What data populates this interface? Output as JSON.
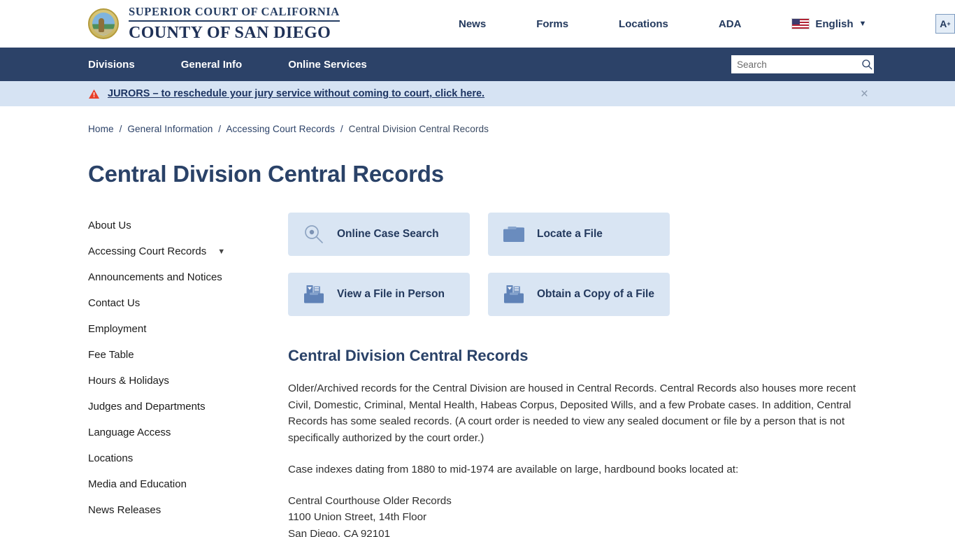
{
  "header": {
    "logo_line1": "SUPERIOR COURT OF CALIFORNIA",
    "logo_line2": "COUNTY OF SAN DIEGO",
    "seal_icon": "california-state-seal",
    "util_nav": [
      {
        "label": "News"
      },
      {
        "label": "Forms"
      },
      {
        "label": "Locations"
      },
      {
        "label": "ADA"
      }
    ],
    "language": {
      "label": "English",
      "flag_icon": "us-flag-icon",
      "caret_icon": "chevron-down-icon"
    },
    "accessibility": {
      "label": "A",
      "sup": "+",
      "name": "increase-text-size"
    }
  },
  "mainnav": {
    "items": [
      {
        "label": "Divisions"
      },
      {
        "label": "General Info"
      },
      {
        "label": "Online Services"
      }
    ],
    "search": {
      "placeholder": "Search",
      "value": "",
      "icon": "search-icon"
    }
  },
  "alert": {
    "icon": "warning-triangle-icon",
    "text": "JURORS – to reschedule your jury service without coming to court, click here.",
    "close_icon": "close-icon",
    "close_label": "×"
  },
  "breadcrumb": {
    "items": [
      {
        "label": "Home",
        "current": false
      },
      {
        "label": "General Information",
        "current": false
      },
      {
        "label": "Accessing Court Records",
        "current": false
      },
      {
        "label": "Central Division Central Records",
        "current": true
      }
    ],
    "separator": "/"
  },
  "page": {
    "title": "Central Division Central Records"
  },
  "sidebar": {
    "items": [
      {
        "label": "About Us",
        "expandable": false
      },
      {
        "label": "Accessing Court Records",
        "expandable": true,
        "caret": "⌄"
      },
      {
        "label": "Announcements and Notices",
        "expandable": false
      },
      {
        "label": "Contact Us",
        "expandable": false
      },
      {
        "label": "Employment",
        "expandable": false
      },
      {
        "label": "Fee Table",
        "expandable": false
      },
      {
        "label": "Hours & Holidays",
        "expandable": false
      },
      {
        "label": "Judges and Departments",
        "expandable": false
      },
      {
        "label": "Language Access",
        "expandable": false
      },
      {
        "label": "Locations",
        "expandable": false
      },
      {
        "label": "Media and Education",
        "expandable": false
      },
      {
        "label": "News Releases",
        "expandable": false
      }
    ]
  },
  "tiles": [
    {
      "label": "Online Case Search",
      "icon": "magnifier-icon"
    },
    {
      "label": "Locate a File",
      "icon": "folder-icon"
    },
    {
      "label": "View a File in Person",
      "icon": "file-box-icon"
    },
    {
      "label": "Obtain a Copy of a File",
      "icon": "file-box-icon"
    }
  ],
  "main": {
    "section_title": "Central Division Central Records",
    "paragraphs": [
      "Older/Archived records for the Central Division are housed in Central Records. Central Records also houses more recent Civil, Domestic, Criminal, Mental Health, Habeas Corpus, Deposited Wills, and a few Probate cases. In addition, Central Records has some sealed records. (A court order is needed to view any sealed document or file by a person that is not specifically authorized by the court order.)",
      "Case indexes dating from 1880 to mid-1974 are available on large, hardbound books located at:"
    ],
    "address": {
      "line1": "Central Courthouse Older Records",
      "line2": "1100 Union Street, 14th Floor",
      "line3": "San Diego, CA 92101"
    }
  },
  "colors": {
    "navy": "#2c4268",
    "tile_bg": "#d9e5f3",
    "alert_bg": "#d6e3f3",
    "accent_blue": "#23395d"
  }
}
